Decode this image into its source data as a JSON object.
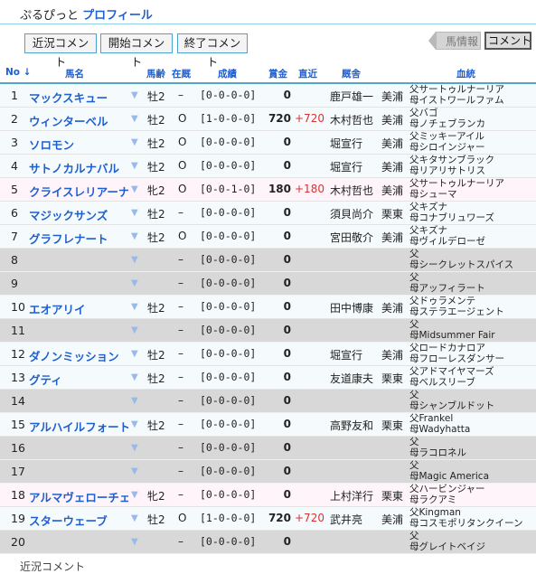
{
  "title": {
    "prefix": "ぷるぴっと ",
    "link": "プロフィール"
  },
  "buttons": {
    "recent": "近況コメント",
    "start": "開始コメント",
    "end": "終了コメント"
  },
  "tabs": {
    "prev": "馬情報",
    "comment": "コメント"
  },
  "header": {
    "no": "No ↓",
    "name": "馬名",
    "age": "馬齢",
    "inst": "在厩",
    "record": "成績",
    "prize": "賞金",
    "recent": "直近",
    "trainer": "厩舎",
    "bloodline": "血統"
  },
  "rows": [
    {
      "no": "1",
      "name": "マックスキュー",
      "sex": "牡2",
      "inst": "–",
      "rec": "[0-0-0-0]",
      "prize": "0",
      "recent": "",
      "trainer": "鹿戸雄一",
      "area": "美浦",
      "sire": "父サートゥルナーリア",
      "dam": "母イストワールファム",
      "bg": "blue"
    },
    {
      "no": "2",
      "name": "ウィンターベル",
      "sex": "牡2",
      "inst": "O",
      "rec": "[1-0-0-0]",
      "prize": "720",
      "recent": "+720",
      "trainer": "木村哲也",
      "area": "美浦",
      "sire": "父バゴ",
      "dam": "母ノチェブランカ",
      "bg": "blue"
    },
    {
      "no": "3",
      "name": "ソロモン",
      "sex": "牡2",
      "inst": "O",
      "rec": "[0-0-0-0]",
      "prize": "0",
      "recent": "",
      "trainer": "堀宣行",
      "area": "美浦",
      "sire": "父ミッキーアイル",
      "dam": "母シロインジャー",
      "bg": "blue"
    },
    {
      "no": "4",
      "name": "サトノカルナバル",
      "sex": "牡2",
      "inst": "O",
      "rec": "[0-0-0-0]",
      "prize": "0",
      "recent": "",
      "trainer": "堀宣行",
      "area": "美浦",
      "sire": "父キタサンブラック",
      "dam": "母リアリサトリス",
      "bg": "blue"
    },
    {
      "no": "5",
      "name": "クライスレリアーナ",
      "sex": "牝2",
      "inst": "O",
      "rec": "[0-0-1-0]",
      "prize": "180",
      "recent": "+180",
      "trainer": "木村哲也",
      "area": "美浦",
      "sire": "父サートゥルナーリア",
      "dam": "母シューマ",
      "bg": "pink"
    },
    {
      "no": "6",
      "name": "マジックサンズ",
      "sex": "牡2",
      "inst": "–",
      "rec": "[0-0-0-0]",
      "prize": "0",
      "recent": "",
      "trainer": "須貝尚介",
      "area": "栗東",
      "sire": "父キズナ",
      "dam": "母コナブリュワーズ",
      "bg": "blue"
    },
    {
      "no": "7",
      "name": "グラフレナート",
      "sex": "牡2",
      "inst": "O",
      "rec": "[0-0-0-0]",
      "prize": "0",
      "recent": "",
      "trainer": "宮田敬介",
      "area": "美浦",
      "sire": "父キズナ",
      "dam": "母ヴィルデローゼ",
      "bg": "blue"
    },
    {
      "no": "8",
      "name": "",
      "sex": "",
      "inst": "–",
      "rec": "[0-0-0-0]",
      "prize": "0",
      "recent": "",
      "trainer": "",
      "area": "",
      "sire": "父",
      "dam": "母シークレットスパイス",
      "bg": "gray"
    },
    {
      "no": "9",
      "name": "",
      "sex": "",
      "inst": "–",
      "rec": "[0-0-0-0]",
      "prize": "0",
      "recent": "",
      "trainer": "",
      "area": "",
      "sire": "父",
      "dam": "母アッフィラート",
      "bg": "gray"
    },
    {
      "no": "10",
      "name": "エオアリイ",
      "sex": "牡2",
      "inst": "–",
      "rec": "[0-0-0-0]",
      "prize": "0",
      "recent": "",
      "trainer": "田中博康",
      "area": "美浦",
      "sire": "父ドゥラメンテ",
      "dam": "母ステラエージェント",
      "bg": "blue"
    },
    {
      "no": "11",
      "name": "",
      "sex": "",
      "inst": "–",
      "rec": "[0-0-0-0]",
      "prize": "0",
      "recent": "",
      "trainer": "",
      "area": "",
      "sire": "父",
      "dam": "母Midsummer Fair",
      "bg": "gray"
    },
    {
      "no": "12",
      "name": "ダノンミッション",
      "sex": "牡2",
      "inst": "–",
      "rec": "[0-0-0-0]",
      "prize": "0",
      "recent": "",
      "trainer": "堀宣行",
      "area": "美浦",
      "sire": "父ロードカナロア",
      "dam": "母フローレスダンサー",
      "bg": "blue"
    },
    {
      "no": "13",
      "name": "グティ",
      "sex": "牡2",
      "inst": "–",
      "rec": "[0-0-0-0]",
      "prize": "0",
      "recent": "",
      "trainer": "友道康夫",
      "area": "栗東",
      "sire": "父アドマイヤマーズ",
      "dam": "母ベルスリーブ",
      "bg": "blue"
    },
    {
      "no": "14",
      "name": "",
      "sex": "",
      "inst": "–",
      "rec": "[0-0-0-0]",
      "prize": "0",
      "recent": "",
      "trainer": "",
      "area": "",
      "sire": "父",
      "dam": "母シャンブルドット",
      "bg": "gray"
    },
    {
      "no": "15",
      "name": "アルハイルフォート",
      "sex": "牡2",
      "inst": "–",
      "rec": "[0-0-0-0]",
      "prize": "0",
      "recent": "",
      "trainer": "高野友和",
      "area": "栗東",
      "sire": "父Frankel",
      "dam": "母Wadyhatta",
      "bg": "blue"
    },
    {
      "no": "16",
      "name": "",
      "sex": "",
      "inst": "–",
      "rec": "[0-0-0-0]",
      "prize": "0",
      "recent": "",
      "trainer": "",
      "area": "",
      "sire": "父",
      "dam": "母ラコロネル",
      "bg": "gray"
    },
    {
      "no": "17",
      "name": "",
      "sex": "",
      "inst": "–",
      "rec": "[0-0-0-0]",
      "prize": "0",
      "recent": "",
      "trainer": "",
      "area": "",
      "sire": "父",
      "dam": "母Magic America",
      "bg": "gray"
    },
    {
      "no": "18",
      "name": "アルマヴェローチェ",
      "sex": "牝2",
      "inst": "–",
      "rec": "[0-0-0-0]",
      "prize": "0",
      "recent": "",
      "trainer": "上村洋行",
      "area": "栗東",
      "sire": "父ハービンジャー",
      "dam": "母ラクアミ",
      "bg": "pink"
    },
    {
      "no": "19",
      "name": "スターウェーブ",
      "sex": "牡2",
      "inst": "O",
      "rec": "[1-0-0-0]",
      "prize": "720",
      "recent": "+720",
      "trainer": "武井亮",
      "area": "美浦",
      "sire": "父Kingman",
      "dam": "母コスモポリタンクイーン",
      "bg": "blue"
    },
    {
      "no": "20",
      "name": "",
      "sex": "",
      "inst": "–",
      "rec": "[0-0-0-0]",
      "prize": "0",
      "recent": "",
      "trainer": "",
      "area": "",
      "sire": "父",
      "dam": "母グレイトベイジ",
      "bg": "gray"
    }
  ],
  "footer": "近況コメント"
}
